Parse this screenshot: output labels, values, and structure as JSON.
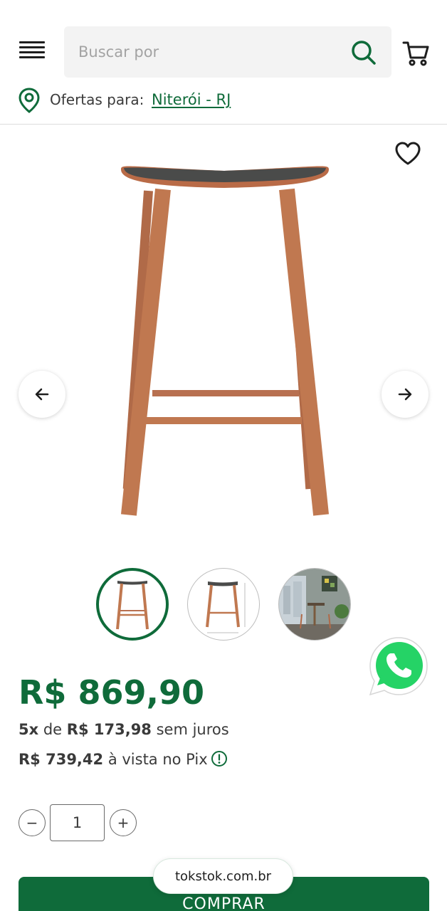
{
  "header": {
    "search_placeholder": "Buscar por",
    "location_label": "Ofertas para:",
    "location_city": "Niterói - RJ"
  },
  "price": {
    "main": "R$ 869,90",
    "installments_count": "5x",
    "installments_mid": " de ",
    "installments_value": "R$ 173,98",
    "installments_suffix": " sem juros",
    "pix_value": "R$ 739,42",
    "pix_suffix": " à vista no Pix"
  },
  "quantity": {
    "value": "1",
    "minus": "−",
    "plus": "+"
  },
  "buy_label": "COMPRAR",
  "url": "tokstok.com.br",
  "colors": {
    "brand_green": "#0f6b3a",
    "whatsapp_green": "#25d366"
  }
}
